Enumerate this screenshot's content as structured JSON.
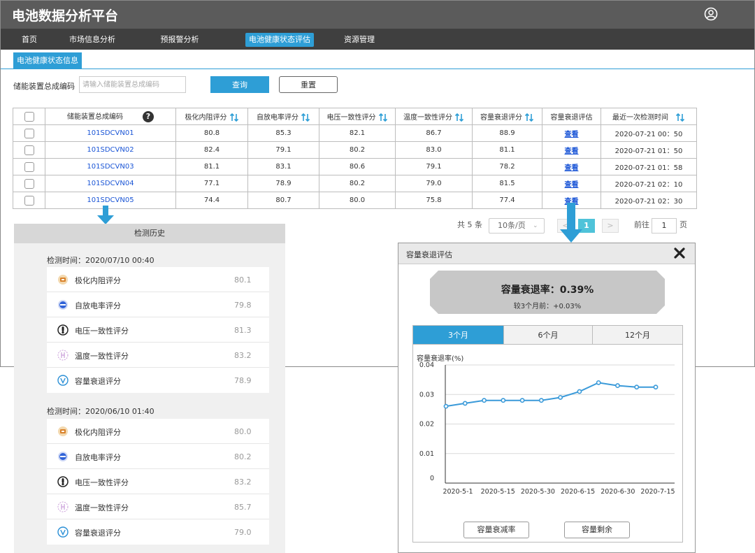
{
  "app": {
    "title": "电池数据分析平台"
  },
  "nav": [
    "首页",
    "市场信息分析",
    "预报警分析",
    "电池健康状态评估",
    "资源管理"
  ],
  "tab": "电池健康状态信息",
  "filter": {
    "label": "储能装置总成编码",
    "placeholder": "请输入储能装置总成编码",
    "query_label": "查询",
    "reset_label": "重置"
  },
  "table": {
    "headers": [
      "储能装置总成编码",
      "极化内阻评分",
      "自放电率评分",
      "电压一致性评分",
      "温度一致性评分",
      "容量衰退评分",
      "容量衰退评估",
      "最近一次检测时间"
    ],
    "help_glyph": "?",
    "rows": [
      {
        "code": "101SDCVN01",
        "polar": "80.8",
        "selfdis": "85.3",
        "volt": "82.1",
        "temp": "86.7",
        "cap": "88.9",
        "view": "查看",
        "time": "2020-07-21  00：50"
      },
      {
        "code": "101SDCVN02",
        "polar": "82.4",
        "selfdis": "79.1",
        "volt": "80.2",
        "temp": "83.0",
        "cap": "81.1",
        "view": "查看",
        "time": "2020-07-21  01：50"
      },
      {
        "code": "101SDCVN03",
        "polar": "81.1",
        "selfdis": "83.1",
        "volt": "80.6",
        "temp": "79.1",
        "cap": "78.2",
        "view": "查看",
        "time": "2020-07-21  01：58"
      },
      {
        "code": "101SDCVN04",
        "polar": "77.1",
        "selfdis": "78.9",
        "volt": "80.2",
        "temp": "79.0",
        "cap": "81.5",
        "view": "查看",
        "time": "2020-07-21  02：10"
      },
      {
        "code": "101SDCVN05",
        "polar": "74.4",
        "selfdis": "80.7",
        "volt": "80.0",
        "temp": "75.8",
        "cap": "77.4",
        "view": "查看",
        "time": "2020-07-21  02：30"
      }
    ]
  },
  "pagination": {
    "total": "共 5 条",
    "page_size": "10条/页",
    "prev": "<",
    "current": "1",
    "next": ">",
    "goto_label": "前往",
    "goto_value": "1",
    "page_unit": "页"
  },
  "history": {
    "title": "检测历史",
    "records": [
      {
        "time": "检测时间：2020/07/10 00:40",
        "items": [
          {
            "icon": "polarization-icon",
            "label": "极化内阻评分",
            "value": "80.1"
          },
          {
            "icon": "self-discharge-icon",
            "label": "自放电率评分",
            "value": "79.8"
          },
          {
            "icon": "voltage-icon",
            "label": "电压一致性评分",
            "value": "81.3"
          },
          {
            "icon": "temperature-icon",
            "label": "温度一致性评分",
            "value": "83.2"
          },
          {
            "icon": "capacity-icon",
            "label": "容量衰退评分",
            "value": "78.9"
          }
        ]
      },
      {
        "time": "检测时间：2020/06/10 01:40",
        "items": [
          {
            "icon": "polarization-icon",
            "label": "极化内阻评分",
            "value": "80.0"
          },
          {
            "icon": "self-discharge-icon",
            "label": "自放电率评分",
            "value": "80.2"
          },
          {
            "icon": "voltage-icon",
            "label": "电压一致性评分",
            "value": "83.2"
          },
          {
            "icon": "temperature-icon",
            "label": "温度一致性评分",
            "value": "85.7"
          },
          {
            "icon": "capacity-icon",
            "label": "容量衰退评分",
            "value": "79.0"
          }
        ]
      }
    ]
  },
  "modal": {
    "title": "容量衰退评估",
    "rate": "容量衰退率：0.39%",
    "change": "较3个月前：+0.03%",
    "tabs": [
      "3个月",
      "6个月",
      "12个月"
    ],
    "active_tab": 0,
    "buttons": [
      "容量衰减率",
      "容量剩余"
    ]
  },
  "colors": {
    "accent": "#2e9ed6",
    "header_bg": "#5b5b5b",
    "nav_bg": "#3f3f3f",
    "link": "#1a55d6",
    "line": "#3a9ad9"
  },
  "chart_data": {
    "type": "line",
    "title": "",
    "ylabel": "容量衰退率(%)",
    "xlabel": "",
    "ylim": [
      0,
      0.04
    ],
    "yticks": [
      "0",
      "0.01",
      "0.02",
      "0.03",
      "0.04"
    ],
    "xtick_labels": [
      "2020-5-1",
      "2020-5-15",
      "2020-5-30",
      "2020-6-15",
      "2020-6-30",
      "2020-7-15"
    ],
    "grid": true,
    "series": [
      {
        "values": [
          0.026,
          0.027,
          0.028,
          0.028,
          0.028,
          0.028,
          0.029,
          0.031,
          0.034,
          0.033,
          0.0325,
          0.0325
        ]
      }
    ]
  }
}
